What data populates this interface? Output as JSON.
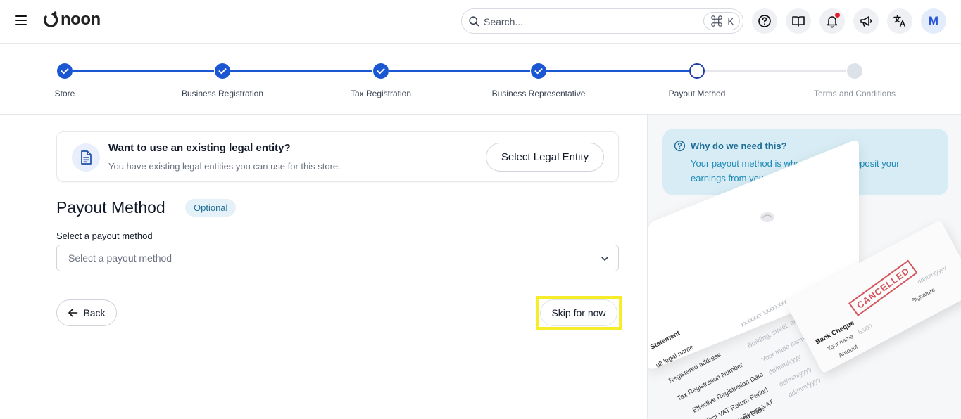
{
  "header": {
    "logo_text": "noon",
    "search_placeholder": "Search...",
    "shortcut_key": "K",
    "avatar_initial": "M"
  },
  "stepper": {
    "steps": [
      {
        "label": "Store",
        "state": "done"
      },
      {
        "label": "Business Registration",
        "state": "done"
      },
      {
        "label": "Tax Registration",
        "state": "done"
      },
      {
        "label": "Business Representative",
        "state": "done"
      },
      {
        "label": "Payout Method",
        "state": "current"
      },
      {
        "label": "Terms and Conditions",
        "state": "pending"
      }
    ],
    "colors": {
      "done": "#1b56d3",
      "pending": "#dde1e8"
    }
  },
  "entity_card": {
    "title": "Want to use an existing legal entity?",
    "subtitle": "You have existing legal entities you can use for this store.",
    "button_label": "Select Legal Entity"
  },
  "payout": {
    "title": "Payout Method",
    "badge": "Optional",
    "field_label": "Select a payout method",
    "select_placeholder": "Select a payout method"
  },
  "actions": {
    "back_label": "Back",
    "skip_label": "Skip for now"
  },
  "info": {
    "title": "Why do we need this?",
    "text": "Your payout method is where noon will deposit your earnings from your sales."
  },
  "illustration": {
    "doc_lines": [
      "Statement",
      "ull legal name",
      "Registered address",
      "Tax Registration Number",
      "Effective Registration Date",
      "First VAT Return Period",
      "date due Return VAT",
      "Issuing Date"
    ],
    "doc_values": [
      "xxxxxxx xxxxxxxx",
      "Building, street, area, city, country",
      "Your trade name",
      "dd/mm/yyyy",
      "dd/mm/yyyy",
      "dd/mm/yyyy"
    ],
    "cheque_title": "Bank Cheque",
    "cheque_name": "Your name",
    "cheque_amount": "Amount",
    "cheque_signature": "Signature",
    "cheque_date": "dd/mm/yyyy",
    "cheque_number": "5,000",
    "stamp": "CANCELLED"
  }
}
